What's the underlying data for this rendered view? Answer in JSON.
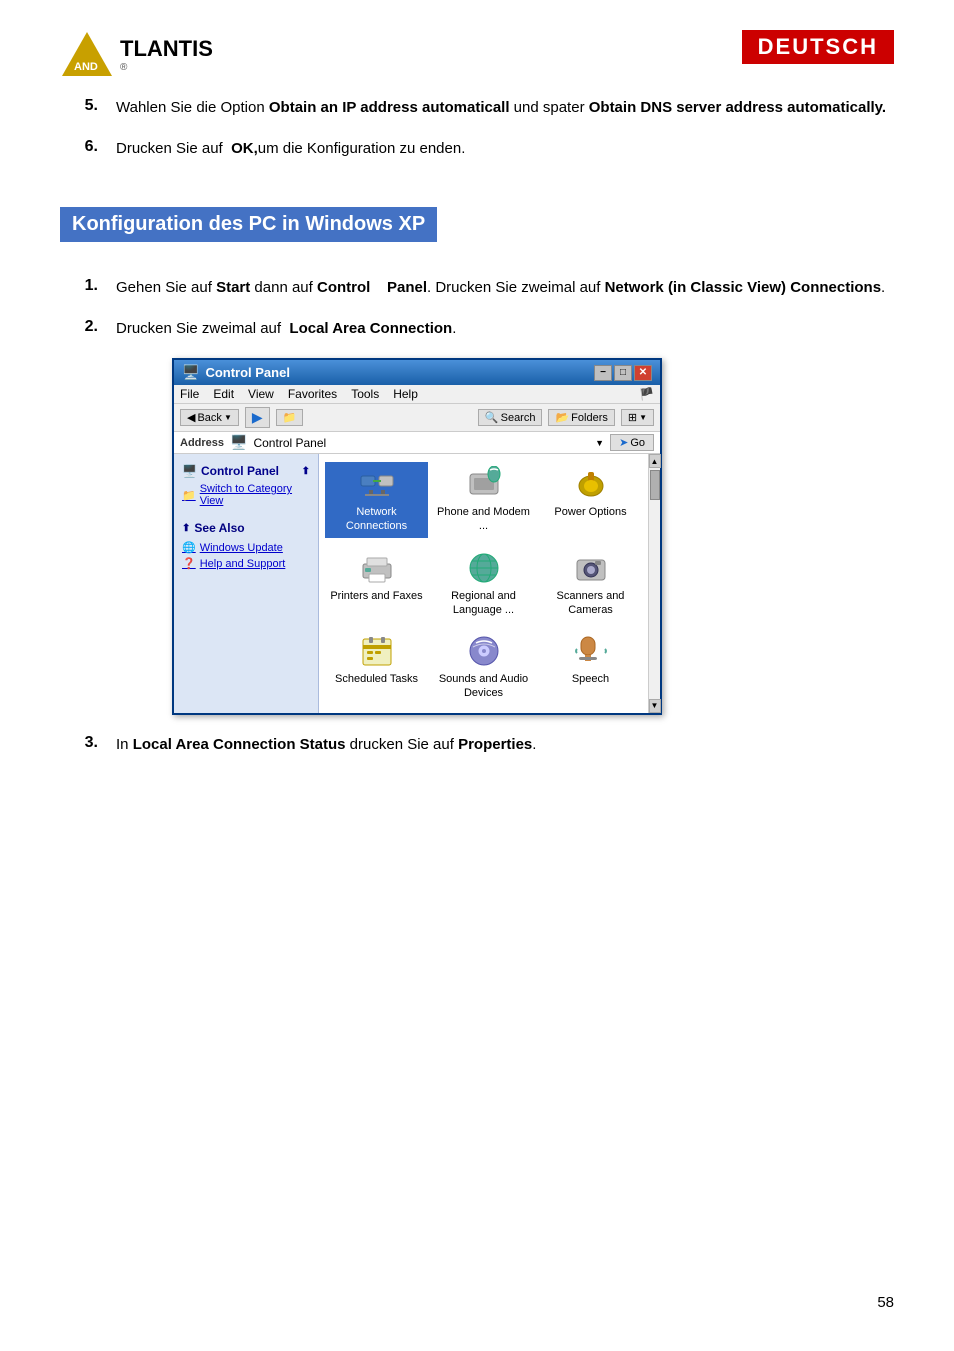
{
  "header": {
    "logo_text": "TLANTIS",
    "logo_sub": "AND",
    "deutsch": "DEUTSCH"
  },
  "steps": {
    "step5_num": "5.",
    "step5_text_normal1": "Wahlen Sie die Option ",
    "step5_bold1": "Obtain an IP address",
    "step5_bold2": "automaticall",
    "step5_text_normal2": " und spater ",
    "step5_bold3": "Obtain DNS server",
    "step5_bold4": "address automatically.",
    "step6_num": "6.",
    "step6_text1": "Drucken Sie auf  ",
    "step6_bold1": "OK,",
    "step6_text2": "um die Konfiguration zu enden."
  },
  "section_title": "Konfiguration des PC in Windows XP",
  "step1": {
    "num": "1.",
    "text1": "Gehen Sie auf ",
    "bold1": "Start",
    "text2": " dann auf ",
    "bold2": "Control",
    "bold3": "Panel",
    "text3": ". Drucken Sie zweimal auf ",
    "bold4": "Network (in Classic View)",
    "bold5": "Connections",
    "text4": "."
  },
  "step2": {
    "num": "2.",
    "text1": "Drucken Sie zweimal auf  ",
    "bold1": "Local Area Connection",
    "text2": "."
  },
  "step3": {
    "num": "3.",
    "text1": "In ",
    "bold1": "Local Area Connection Status",
    "text2": " drucken Sie auf ",
    "bold2": "Properties",
    "text3": "."
  },
  "control_panel": {
    "title": "Control Panel",
    "menu": [
      "File",
      "Edit",
      "View",
      "Favorites",
      "Tools",
      "Help"
    ],
    "toolbar": {
      "back": "Back",
      "search": "Search",
      "folders": "Folders"
    },
    "address_label": "Address",
    "address_value": "Control Panel",
    "go": "Go",
    "sidebar": {
      "title": "Control Panel",
      "switch_label": "Switch to Category View",
      "see_also": "See Also",
      "links": [
        "Windows Update",
        "Help and Support"
      ]
    },
    "items": [
      {
        "label": "Network\nConnections",
        "selected": true
      },
      {
        "label": "Phone and\nModem ...",
        "selected": false
      },
      {
        "label": "Power Options",
        "selected": false
      },
      {
        "label": "Printers and\nFaxes",
        "selected": false
      },
      {
        "label": "Regional and\nLanguage ...",
        "selected": false
      },
      {
        "label": "Scanners and\nCameras",
        "selected": false
      },
      {
        "label": "Scheduled\nTasks",
        "selected": false
      },
      {
        "label": "Sounds and\nAudio Devices",
        "selected": false
      },
      {
        "label": "Speech",
        "selected": false
      }
    ]
  },
  "page_number": "58"
}
